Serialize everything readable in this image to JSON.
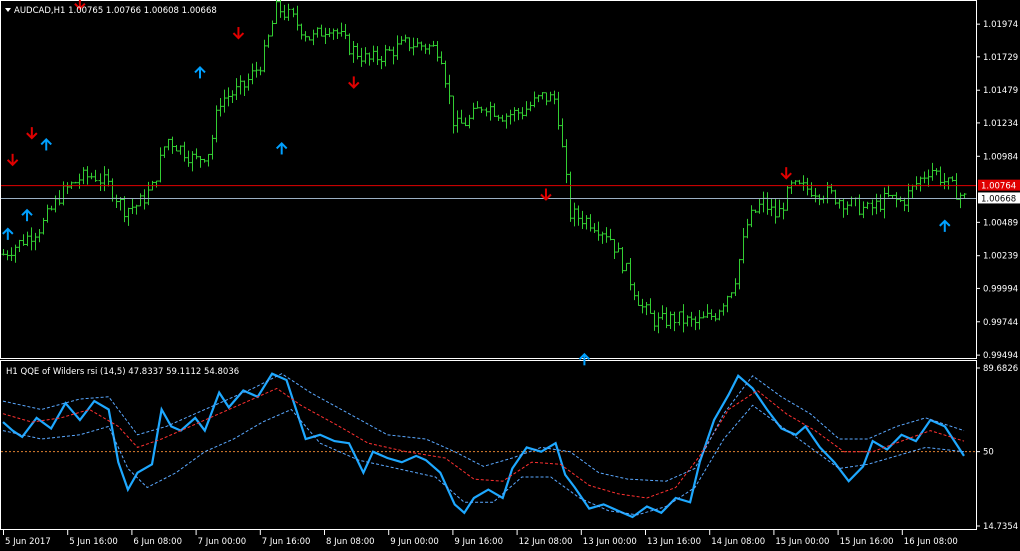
{
  "chart_data": [
    {
      "type": "ohlc-bar",
      "title": "AUDCAD,H1  1.00765 1.00766 1.00608 1.00668",
      "symbol": "AUDCAD",
      "timeframe": "H1",
      "last_ohlc": {
        "open": 1.00765,
        "high": 1.00766,
        "low": 1.00608,
        "close": 1.00668
      },
      "y_ticks": [
        "1.01974",
        "1.01729",
        "1.01479",
        "1.01234",
        "1.00984",
        "1.00489",
        "1.00239",
        "0.99994",
        "0.99744",
        "0.99494"
      ],
      "ylim": [
        0.9948,
        1.0214
      ],
      "bid_line": {
        "value": 1.00668,
        "label": "1.00668",
        "color": "#9BB0C4"
      },
      "ask_line": {
        "value": 1.00764,
        "label": "1.00764",
        "color": "#E00000"
      },
      "bar_color": "#32CD32",
      "close_path": [
        {
          "x": 0.0,
          "close": 1.0025
        },
        {
          "x": 0.02,
          "close": 1.0035
        },
        {
          "x": 0.04,
          "close": 1.0046
        },
        {
          "x": 0.06,
          "close": 1.007
        },
        {
          "x": 0.08,
          "close": 1.0082
        },
        {
          "x": 0.095,
          "close": 1.0084
        },
        {
          "x": 0.11,
          "close": 1.0076
        },
        {
          "x": 0.125,
          "close": 1.0059
        },
        {
          "x": 0.14,
          "close": 1.0062
        },
        {
          "x": 0.155,
          "close": 1.0075
        },
        {
          "x": 0.17,
          "close": 1.0112
        },
        {
          "x": 0.185,
          "close": 1.0104
        },
        {
          "x": 0.2,
          "close": 1.0095
        },
        {
          "x": 0.215,
          "close": 1.0103
        },
        {
          "x": 0.225,
          "close": 1.014
        },
        {
          "x": 0.25,
          "close": 1.015
        },
        {
          "x": 0.27,
          "close": 1.017
        },
        {
          "x": 0.285,
          "close": 1.021
        },
        {
          "x": 0.3,
          "close": 1.0202
        },
        {
          "x": 0.32,
          "close": 1.0186
        },
        {
          "x": 0.34,
          "close": 1.0197
        },
        {
          "x": 0.36,
          "close": 1.018
        },
        {
          "x": 0.38,
          "close": 1.017
        },
        {
          "x": 0.4,
          "close": 1.0176
        },
        {
          "x": 0.42,
          "close": 1.0183
        },
        {
          "x": 0.44,
          "close": 1.0181
        },
        {
          "x": 0.455,
          "close": 1.0178
        },
        {
          "x": 0.47,
          "close": 1.012
        },
        {
          "x": 0.485,
          "close": 1.0125
        },
        {
          "x": 0.5,
          "close": 1.0138
        },
        {
          "x": 0.52,
          "close": 1.0129
        },
        {
          "x": 0.54,
          "close": 1.0132
        },
        {
          "x": 0.56,
          "close": 1.0143
        },
        {
          "x": 0.575,
          "close": 1.0141
        },
        {
          "x": 0.59,
          "close": 1.0055
        },
        {
          "x": 0.61,
          "close": 1.005
        },
        {
          "x": 0.63,
          "close": 1.004
        },
        {
          "x": 0.65,
          "close": 1.001
        },
        {
          "x": 0.665,
          "close": 0.9985
        },
        {
          "x": 0.68,
          "close": 0.9974
        },
        {
          "x": 0.7,
          "close": 0.9977
        },
        {
          "x": 0.72,
          "close": 0.9973
        },
        {
          "x": 0.74,
          "close": 0.998
        },
        {
          "x": 0.76,
          "close": 1.0003
        },
        {
          "x": 0.775,
          "close": 1.005
        },
        {
          "x": 0.79,
          "close": 1.0064
        },
        {
          "x": 0.805,
          "close": 1.0053
        },
        {
          "x": 0.82,
          "close": 1.0075
        },
        {
          "x": 0.84,
          "close": 1.0074
        },
        {
          "x": 0.86,
          "close": 1.007
        },
        {
          "x": 0.88,
          "close": 1.0063
        },
        {
          "x": 0.9,
          "close": 1.0058
        },
        {
          "x": 0.92,
          "close": 1.0067
        },
        {
          "x": 0.935,
          "close": 1.0064
        },
        {
          "x": 0.95,
          "close": 1.0078
        },
        {
          "x": 0.965,
          "close": 1.009
        },
        {
          "x": 0.98,
          "close": 1.0079
        },
        {
          "x": 1.0,
          "close": 1.0067
        }
      ],
      "up_arrows": [
        {
          "x": 1.00401,
          "y": 1.0044,
          "color": "#00A0FF"
        },
        {
          "x": 1.00405,
          "y": 1.0058,
          "color": "#00A0FF"
        },
        {
          "x": 1.00409,
          "y": 1.0111,
          "color": "#00A0FF"
        },
        {
          "x": 1.00441,
          "y": 1.0165,
          "color": "#00A0FF"
        },
        {
          "x": 1.00458,
          "y": 1.0108,
          "color": "#00A0FF"
        },
        {
          "x": 1.00521,
          "y": 0.995,
          "color": "#00A0FF"
        },
        {
          "x": 1.00596,
          "y": 1.005,
          "color": "#00A0FF"
        }
      ],
      "down_arrows": [
        {
          "x": 1.00402,
          "y": 1.0092,
          "color": "#E00000"
        },
        {
          "x": 1.00406,
          "y": 1.0112,
          "color": "#E00000"
        },
        {
          "x": 1.00416,
          "y": 1.0209,
          "color": "#E00000"
        },
        {
          "x": 1.00449,
          "y": 1.0187,
          "color": "#E00000"
        },
        {
          "x": 1.00473,
          "y": 1.015,
          "color": "#E00000"
        },
        {
          "x": 1.00513,
          "y": 1.0066,
          "color": "#E00000"
        },
        {
          "x": 1.00563,
          "y": 1.0082,
          "color": "#E00000"
        }
      ]
    },
    {
      "type": "line",
      "title": "H1 QQE of Wilders rsi (14,5) 47.8337 59.1112 54.8036",
      "y_ticks": [
        "89.6826",
        "50",
        "14.7354"
      ],
      "ylim": [
        14.7354,
        89.6826
      ],
      "level_line": {
        "value": 50,
        "color": "#E08030"
      },
      "series": [
        {
          "color": "#1EA8FF",
          "style": "solid",
          "values": [
            [
              0,
              64
            ],
            [
              0.01,
              60
            ],
            [
              0.02,
              57
            ],
            [
              0.035,
              66
            ],
            [
              0.05,
              61
            ],
            [
              0.065,
              73
            ],
            [
              0.08,
              65
            ],
            [
              0.095,
              74
            ],
            [
              0.11,
              70
            ],
            [
              0.12,
              45
            ],
            [
              0.13,
              32
            ],
            [
              0.14,
              40
            ],
            [
              0.155,
              44
            ],
            [
              0.165,
              70
            ],
            [
              0.175,
              62
            ],
            [
              0.185,
              60
            ],
            [
              0.2,
              66
            ],
            [
              0.21,
              60
            ],
            [
              0.225,
              78
            ],
            [
              0.235,
              71
            ],
            [
              0.25,
              79
            ],
            [
              0.265,
              76
            ],
            [
              0.28,
              87
            ],
            [
              0.295,
              84
            ],
            [
              0.305,
              70
            ],
            [
              0.315,
              56
            ],
            [
              0.33,
              58
            ],
            [
              0.345,
              55
            ],
            [
              0.36,
              54
            ],
            [
              0.375,
              40
            ],
            [
              0.385,
              50
            ],
            [
              0.4,
              47
            ],
            [
              0.415,
              45
            ],
            [
              0.43,
              48
            ],
            [
              0.44,
              46
            ],
            [
              0.455,
              40
            ],
            [
              0.47,
              25
            ],
            [
              0.48,
              21
            ],
            [
              0.49,
              28
            ],
            [
              0.505,
              32
            ],
            [
              0.52,
              28
            ],
            [
              0.53,
              42
            ],
            [
              0.545,
              52
            ],
            [
              0.56,
              50
            ],
            [
              0.575,
              54
            ],
            [
              0.585,
              39
            ],
            [
              0.595,
              33
            ],
            [
              0.61,
              23
            ],
            [
              0.625,
              25
            ],
            [
              0.64,
              22
            ],
            [
              0.655,
              19
            ],
            [
              0.67,
              24
            ],
            [
              0.685,
              21
            ],
            [
              0.7,
              28
            ],
            [
              0.715,
              26
            ],
            [
              0.725,
              45
            ],
            [
              0.74,
              65
            ],
            [
              0.755,
              77
            ],
            [
              0.765,
              86
            ],
            [
              0.78,
              80
            ],
            [
              0.795,
              70
            ],
            [
              0.81,
              61
            ],
            [
              0.825,
              58
            ],
            [
              0.835,
              62
            ],
            [
              0.85,
              52
            ],
            [
              0.865,
              45
            ],
            [
              0.88,
              36
            ],
            [
              0.895,
              43
            ],
            [
              0.905,
              55
            ],
            [
              0.92,
              51
            ],
            [
              0.935,
              58
            ],
            [
              0.95,
              55
            ],
            [
              0.965,
              65
            ],
            [
              0.98,
              62
            ],
            [
              1.0,
              48
            ]
          ]
        },
        {
          "color": "#FF3030",
          "style": "dashed",
          "values": [
            [
              0,
              68
            ],
            [
              0.03,
              64
            ],
            [
              0.06,
              66
            ],
            [
              0.09,
              70
            ],
            [
              0.12,
              62
            ],
            [
              0.14,
              52
            ],
            [
              0.165,
              56
            ],
            [
              0.195,
              62
            ],
            [
              0.225,
              68
            ],
            [
              0.255,
              74
            ],
            [
              0.285,
              80
            ],
            [
              0.31,
              72
            ],
            [
              0.35,
              62
            ],
            [
              0.38,
              54
            ],
            [
              0.42,
              50
            ],
            [
              0.46,
              47
            ],
            [
              0.49,
              37
            ],
            [
              0.52,
              36
            ],
            [
              0.55,
              45
            ],
            [
              0.58,
              44
            ],
            [
              0.61,
              34
            ],
            [
              0.64,
              30
            ],
            [
              0.67,
              28
            ],
            [
              0.7,
              33
            ],
            [
              0.725,
              48
            ],
            [
              0.755,
              70
            ],
            [
              0.785,
              79
            ],
            [
              0.815,
              68
            ],
            [
              0.845,
              60
            ],
            [
              0.875,
              50
            ],
            [
              0.905,
              50
            ],
            [
              0.935,
              55
            ],
            [
              0.965,
              60
            ],
            [
              1.0,
              55
            ]
          ]
        },
        {
          "color": "#5AA8FF",
          "style": "dashed",
          "values": [
            [
              0,
              74
            ],
            [
              0.04,
              70
            ],
            [
              0.08,
              75
            ],
            [
              0.11,
              76
            ],
            [
              0.14,
              58
            ],
            [
              0.17,
              62
            ],
            [
              0.2,
              68
            ],
            [
              0.23,
              74
            ],
            [
              0.26,
              80
            ],
            [
              0.29,
              87
            ],
            [
              0.32,
              78
            ],
            [
              0.36,
              68
            ],
            [
              0.4,
              58
            ],
            [
              0.44,
              56
            ],
            [
              0.47,
              50
            ],
            [
              0.5,
              43
            ],
            [
              0.53,
              47
            ],
            [
              0.56,
              52
            ],
            [
              0.59,
              50
            ],
            [
              0.62,
              40
            ],
            [
              0.65,
              37
            ],
            [
              0.69,
              36
            ],
            [
              0.72,
              42
            ],
            [
              0.75,
              68
            ],
            [
              0.78,
              86
            ],
            [
              0.81,
              76
            ],
            [
              0.84,
              68
            ],
            [
              0.87,
              56
            ],
            [
              0.9,
              56
            ],
            [
              0.93,
              62
            ],
            [
              0.96,
              66
            ],
            [
              1.0,
              60
            ]
          ]
        },
        {
          "color": "#5AA8FF",
          "style": "dashed",
          "values": [
            [
              0,
              60
            ],
            [
              0.04,
              56
            ],
            [
              0.08,
              58
            ],
            [
              0.11,
              62
            ],
            [
              0.13,
              42
            ],
            [
              0.15,
              33
            ],
            [
              0.18,
              40
            ],
            [
              0.21,
              50
            ],
            [
              0.24,
              56
            ],
            [
              0.27,
              64
            ],
            [
              0.3,
              70
            ],
            [
              0.33,
              54
            ],
            [
              0.37,
              46
            ],
            [
              0.41,
              42
            ],
            [
              0.45,
              38
            ],
            [
              0.48,
              26
            ],
            [
              0.51,
              26
            ],
            [
              0.54,
              38
            ],
            [
              0.57,
              38
            ],
            [
              0.6,
              28
            ],
            [
              0.63,
              22
            ],
            [
              0.66,
              20
            ],
            [
              0.69,
              24
            ],
            [
              0.72,
              33
            ],
            [
              0.75,
              56
            ],
            [
              0.78,
              72
            ],
            [
              0.81,
              62
            ],
            [
              0.84,
              52
            ],
            [
              0.87,
              42
            ],
            [
              0.9,
              44
            ],
            [
              0.93,
              48
            ],
            [
              0.96,
              52
            ],
            [
              1.0,
              50
            ]
          ]
        }
      ]
    }
  ],
  "x_ticks": [
    "5 Jun 2017",
    "5 Jun 16:00",
    "6 Jun 08:00",
    "7 Jun 00:00",
    "7 Jun 16:00",
    "8 Jun 08:00",
    "9 Jun 00:00",
    "9 Jun 16:00",
    "12 Jun 08:00",
    "13 Jun 00:00",
    "13 Jun 16:00",
    "14 Jun 08:00",
    "15 Jun 00:00",
    "15 Jun 16:00",
    "16 Jun 08:00"
  ],
  "colors": {
    "background": "#000000",
    "frame": "#FFFFFF",
    "bars": "#32CD32",
    "text": "#FFFFFF"
  }
}
